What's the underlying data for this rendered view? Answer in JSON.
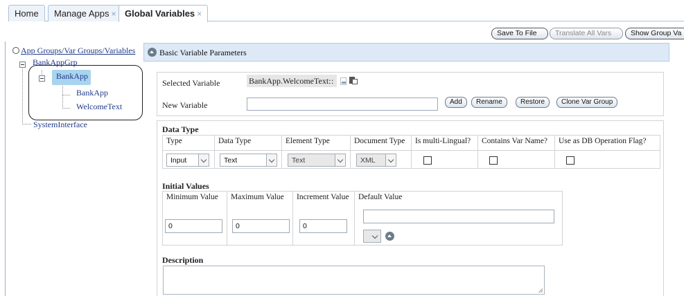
{
  "tabs": [
    {
      "label": "Home",
      "closable": false
    },
    {
      "label": "Manage Apps",
      "closable": true
    },
    {
      "label": "Global Variables",
      "closable": true,
      "active": true
    }
  ],
  "close_glyph": "×",
  "toolbar": {
    "save_to_file": "Save To File",
    "translate_all_vars": "Translate All Vars",
    "show_group_vars": "Show Group Va"
  },
  "tree": {
    "root_label": "App Groups/Var Groups/Variables",
    "app_group": "BankAppGrp",
    "var_group": "BankApp",
    "child_bankapp": "BankApp",
    "child_welcometext": "WelcomeText",
    "system_interface": "SystemInterface"
  },
  "panel": {
    "header": "Basic Variable Parameters",
    "selected_variable_label": "Selected Variable",
    "selected_variable_value": "BankApp.WelcomeText:",
    "new_variable_label": "New Variable",
    "new_variable_value": "",
    "buttons": {
      "add": "Add",
      "rename": "Rename",
      "restore": "Restore",
      "clone_var_group": "Clone Var Group"
    }
  },
  "data_type": {
    "section_title": "Data Type",
    "headers": [
      "Type",
      "Data Type",
      "Element Type",
      "Document Type",
      "Is multi-Lingual?",
      "Contains Var Name?",
      "Use as DB Operation Flag?"
    ],
    "type_value": "Input",
    "data_type_value": "Text",
    "element_type_value": "Text",
    "document_type_value": "XML",
    "is_multilingual": false,
    "contains_var_name": false,
    "use_as_db_flag": false
  },
  "initial_values": {
    "section_title": "Initial Values",
    "headers": [
      "Minimum Value",
      "Maximum Value",
      "Increment Value",
      "Default Value"
    ],
    "minimum": "0",
    "maximum": "0",
    "increment": "0",
    "default": ""
  },
  "description": {
    "section_title": "Description",
    "value": ""
  },
  "colors": {
    "tab_border": "#a8c1dc",
    "panel_header_bg": "#dde9f6",
    "selection_bg": "#a9d4ef",
    "tree_link": "#1f3a88"
  }
}
